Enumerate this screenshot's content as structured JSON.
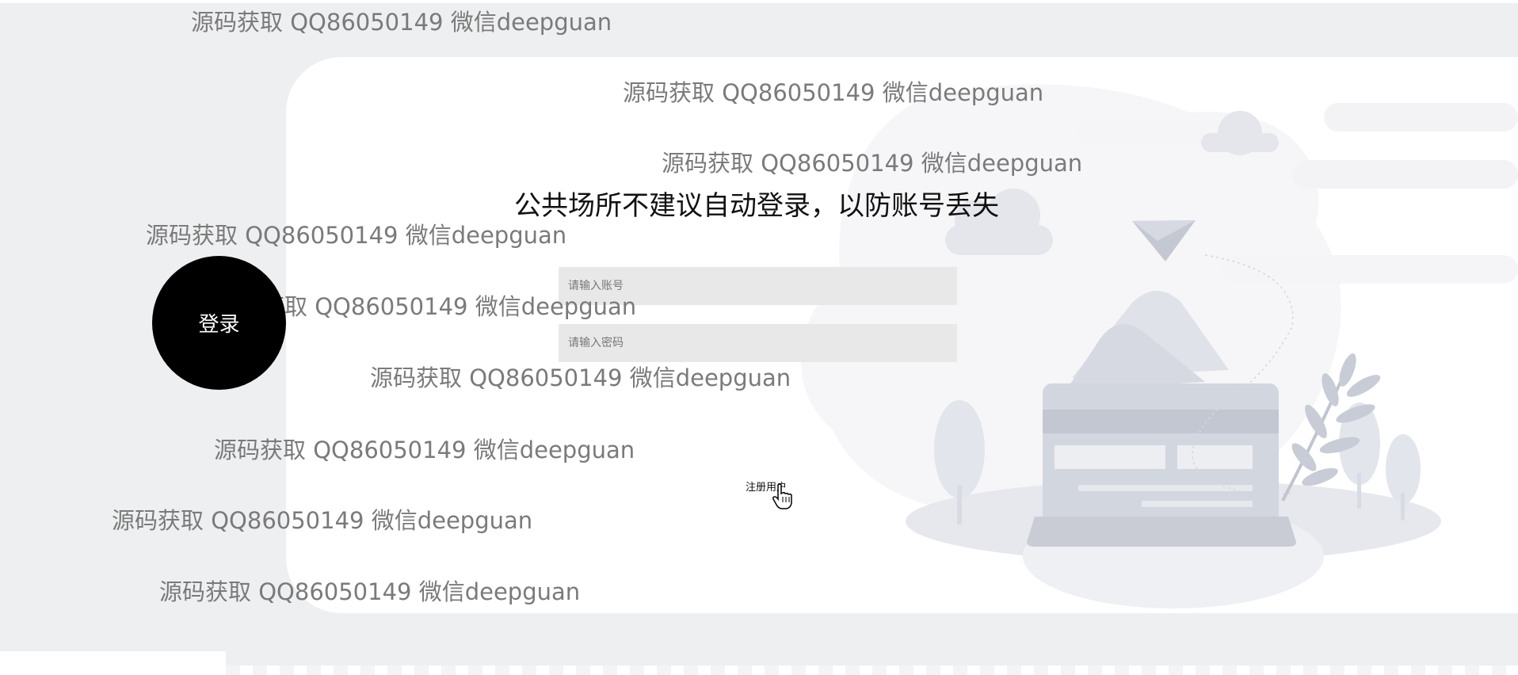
{
  "notice": "公共场所不建议自动登录，以防账号丢失",
  "account_input": {
    "placeholder": "请输入账号",
    "value": ""
  },
  "password_input": {
    "placeholder": "请输入密码",
    "value": ""
  },
  "login_button": "登录",
  "register_link": "注册用户",
  "watermark_text": "源码获取 QQ86050149 微信deepguan",
  "colors": {
    "page_bg": "#eeeff1",
    "card_bg": "#ffffff",
    "button_bg": "#000000",
    "input_bg": "#e8e8e8",
    "watermark": "#7a7a7a"
  },
  "icons": [
    "paper-plane-icon",
    "credit-card-illustration",
    "plant-illustration",
    "cloud-icon",
    "hand-pointer-cursor-icon"
  ]
}
